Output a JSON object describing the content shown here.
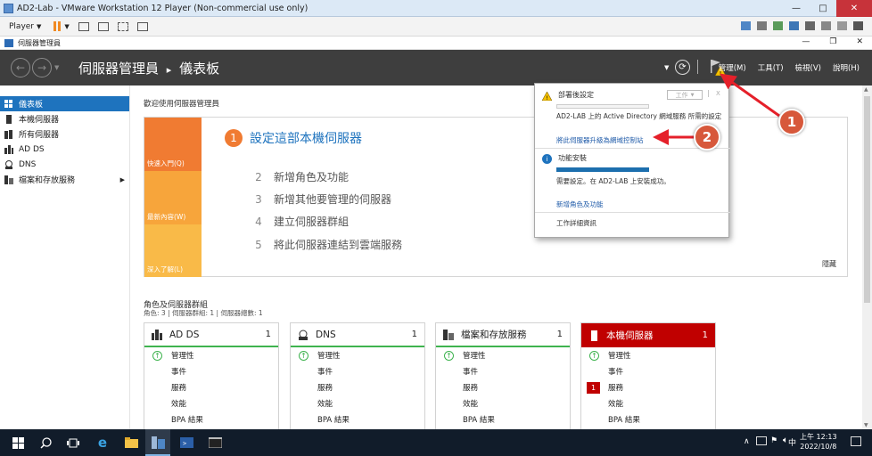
{
  "vm": {
    "title": "AD2-Lab - VMware Workstation 12 Player (Non-commercial use only)",
    "player_label": "Player",
    "minimize": "—",
    "maximize": "□",
    "close": "✕"
  },
  "server_manager": {
    "window_title": "伺服器管理員",
    "breadcrumb_app": "伺服器管理員",
    "breadcrumb_sep": "▸",
    "breadcrumb_page": "儀表板",
    "menus": [
      "管理(M)",
      "工具(T)",
      "檢視(V)",
      "說明(H)"
    ]
  },
  "sidebar": {
    "items": [
      {
        "label": "儀表板",
        "icon": "dashboard-icon",
        "active": true
      },
      {
        "label": "本機伺服器",
        "icon": "server-icon"
      },
      {
        "label": "所有伺服器",
        "icon": "servers-icon"
      },
      {
        "label": "AD DS",
        "icon": "adds-icon"
      },
      {
        "label": "DNS",
        "icon": "dns-icon"
      },
      {
        "label": "檔案和存放服務",
        "icon": "file-storage-icon",
        "has_arrow": true
      }
    ]
  },
  "welcome": {
    "heading": "歡迎使用伺服器管理員",
    "tiles": [
      "快速入門(Q)",
      "最新內容(W)",
      "深入了解(L)"
    ],
    "steps": [
      {
        "num": "1",
        "label": "設定這部本機伺服器"
      },
      {
        "num": "2",
        "label": "新增角色及功能"
      },
      {
        "num": "3",
        "label": "新增其他要管理的伺服器"
      },
      {
        "num": "4",
        "label": "建立伺服器群組"
      },
      {
        "num": "5",
        "label": "將此伺服器連結到雲端服務"
      }
    ],
    "hide_label": "隱藏"
  },
  "roles": {
    "heading": "角色及伺服器群組",
    "subheading": "角色: 3 | 伺服器群組: 1 | 伺服器總數: 1",
    "cards": [
      {
        "title": "AD DS",
        "count": "1",
        "rows": [
          "管理性",
          "事件",
          "服務",
          "效能",
          "BPA 結果"
        ],
        "icon": "adds-icon"
      },
      {
        "title": "DNS",
        "count": "1",
        "rows": [
          "管理性",
          "事件",
          "服務",
          "效能",
          "BPA 結果"
        ],
        "icon": "dns-icon"
      },
      {
        "title": "檔案和存放服務",
        "count": "1",
        "rows": [
          "管理性",
          "事件",
          "服務",
          "效能",
          "BPA 結果"
        ],
        "icon": "file-storage-icon"
      },
      {
        "title": "本機伺服器",
        "count": "1",
        "rows": [
          "管理性",
          "事件",
          "服務",
          "效能",
          "BPA 結果"
        ],
        "icon": "server-icon",
        "services_alert": "1"
      }
    ]
  },
  "notification": {
    "post_deploy_title": "部署後設定",
    "task_button": "工作",
    "post_deploy_desc": "AD2-LAB 上的 Active Directory 網域服務 所需的設定",
    "promote_link": "將此伺服器升級為網域控制站",
    "feature_title": "功能安裝",
    "feature_desc": "需要設定。在 AD2-LAB 上安裝成功。",
    "add_roles_link": "新增角色及功能",
    "task_details": "工作詳細資訊",
    "close_x": "X",
    "pin": "|"
  },
  "callouts": [
    "1",
    "2"
  ],
  "taskbar": {
    "ime": "中",
    "time": "上午 12:13",
    "date": "2022/10/8"
  },
  "colors": {
    "accent": "#1e73be",
    "alert_red": "#c00000",
    "quickstart_orange": "#f07b32",
    "callout": "#d7583b",
    "arrow": "#e5202a"
  }
}
